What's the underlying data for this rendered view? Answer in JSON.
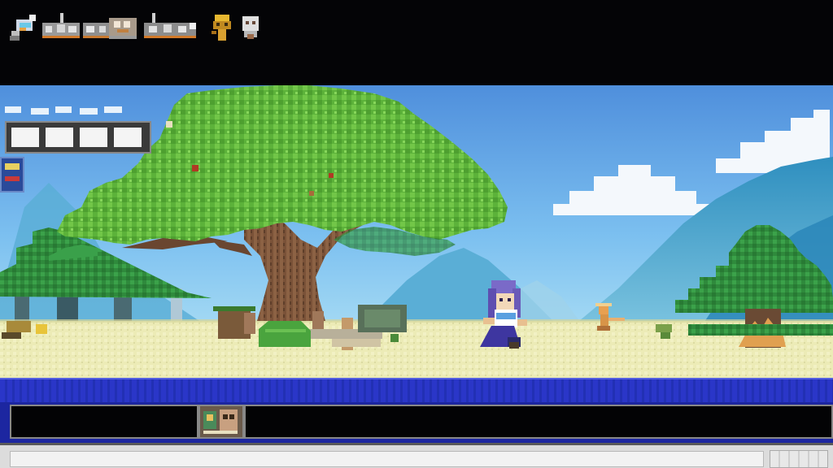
{
  "hud": {
    "icons": [
      "sword-icon",
      "bones-icon",
      "bones-icon",
      "bones-icon",
      "bones-icon",
      "totem-icon",
      "skull-icon"
    ]
  },
  "health_bar": {
    "segments": 4,
    "filled": 4
  },
  "scene": {
    "sky_color": "#5fa6e8",
    "ground_color": "#ecebb4",
    "tree_color": "#5fb33a",
    "mountain_color": "#3a9bc2"
  },
  "player": {
    "icon": "purple-haired-hero"
  },
  "npc": {
    "icon": "small-orange-creature"
  },
  "inventory": {
    "slots": [
      "empty",
      "item",
      "empty"
    ]
  }
}
